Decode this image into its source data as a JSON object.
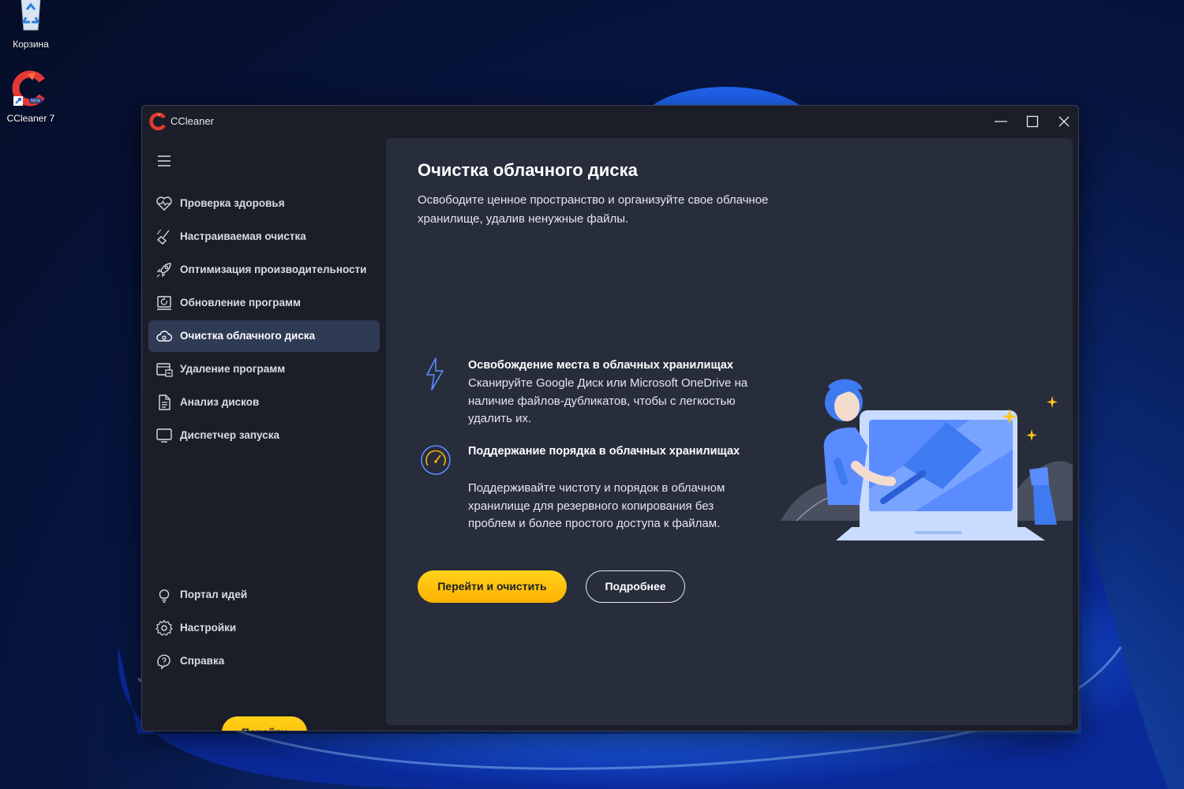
{
  "desktop": {
    "icons": [
      {
        "label": "Корзина"
      },
      {
        "label": "CCleaner 7"
      }
    ]
  },
  "window": {
    "title": "CCleaner"
  },
  "sidebar": {
    "items": [
      {
        "label": "Проверка здоровья",
        "icon": "heart-icon"
      },
      {
        "label": "Настраиваемая очистка",
        "icon": "broom-icon"
      },
      {
        "label": "Оптимизация производительности",
        "icon": "rocket-icon"
      },
      {
        "label": "Обновление программ",
        "icon": "update-icon"
      },
      {
        "label": "Очистка облачного диска",
        "icon": "cloud-clean-icon",
        "active": true
      },
      {
        "label": "Удаление программ",
        "icon": "uninstall-icon"
      },
      {
        "label": "Анализ дисков",
        "icon": "disk-analysis-icon"
      },
      {
        "label": "Диспетчер запуска",
        "icon": "monitor-icon"
      }
    ],
    "bottom_items": [
      {
        "label": "Портал идей",
        "icon": "lightbulb-icon"
      },
      {
        "label": "Настройки",
        "icon": "gear-icon"
      },
      {
        "label": "Справка",
        "icon": "help-icon"
      }
    ],
    "go_button": "Перейти"
  },
  "main": {
    "title": "Очистка облачного диска",
    "description": "Освободите ценное пространство и организуйте свое облачное хранилище, удалив ненужные файлы.",
    "features": [
      {
        "title": "Освобождение места в облачных хранилищах",
        "description": "Сканируйте Google Диск или Microsoft OneDrive на наличие файлов-дубликатов, чтобы с легкостью удалить их.",
        "icon": "lightning-icon"
      },
      {
        "title": "Поддержание порядка в облачных хранилищах",
        "description": "Поддерживайте чистоту и порядок в облачном хранилище для резервного копирования без проблем и более простого доступа к файлам.",
        "icon": "speedometer-icon"
      }
    ],
    "primary_button": "Перейти и очистить",
    "secondary_button": "Подробнее"
  },
  "colors": {
    "accent": "#ffb100",
    "sidebar_active": "#2f3a54",
    "panel": "#282d3c",
    "window": "#1b1e29"
  }
}
